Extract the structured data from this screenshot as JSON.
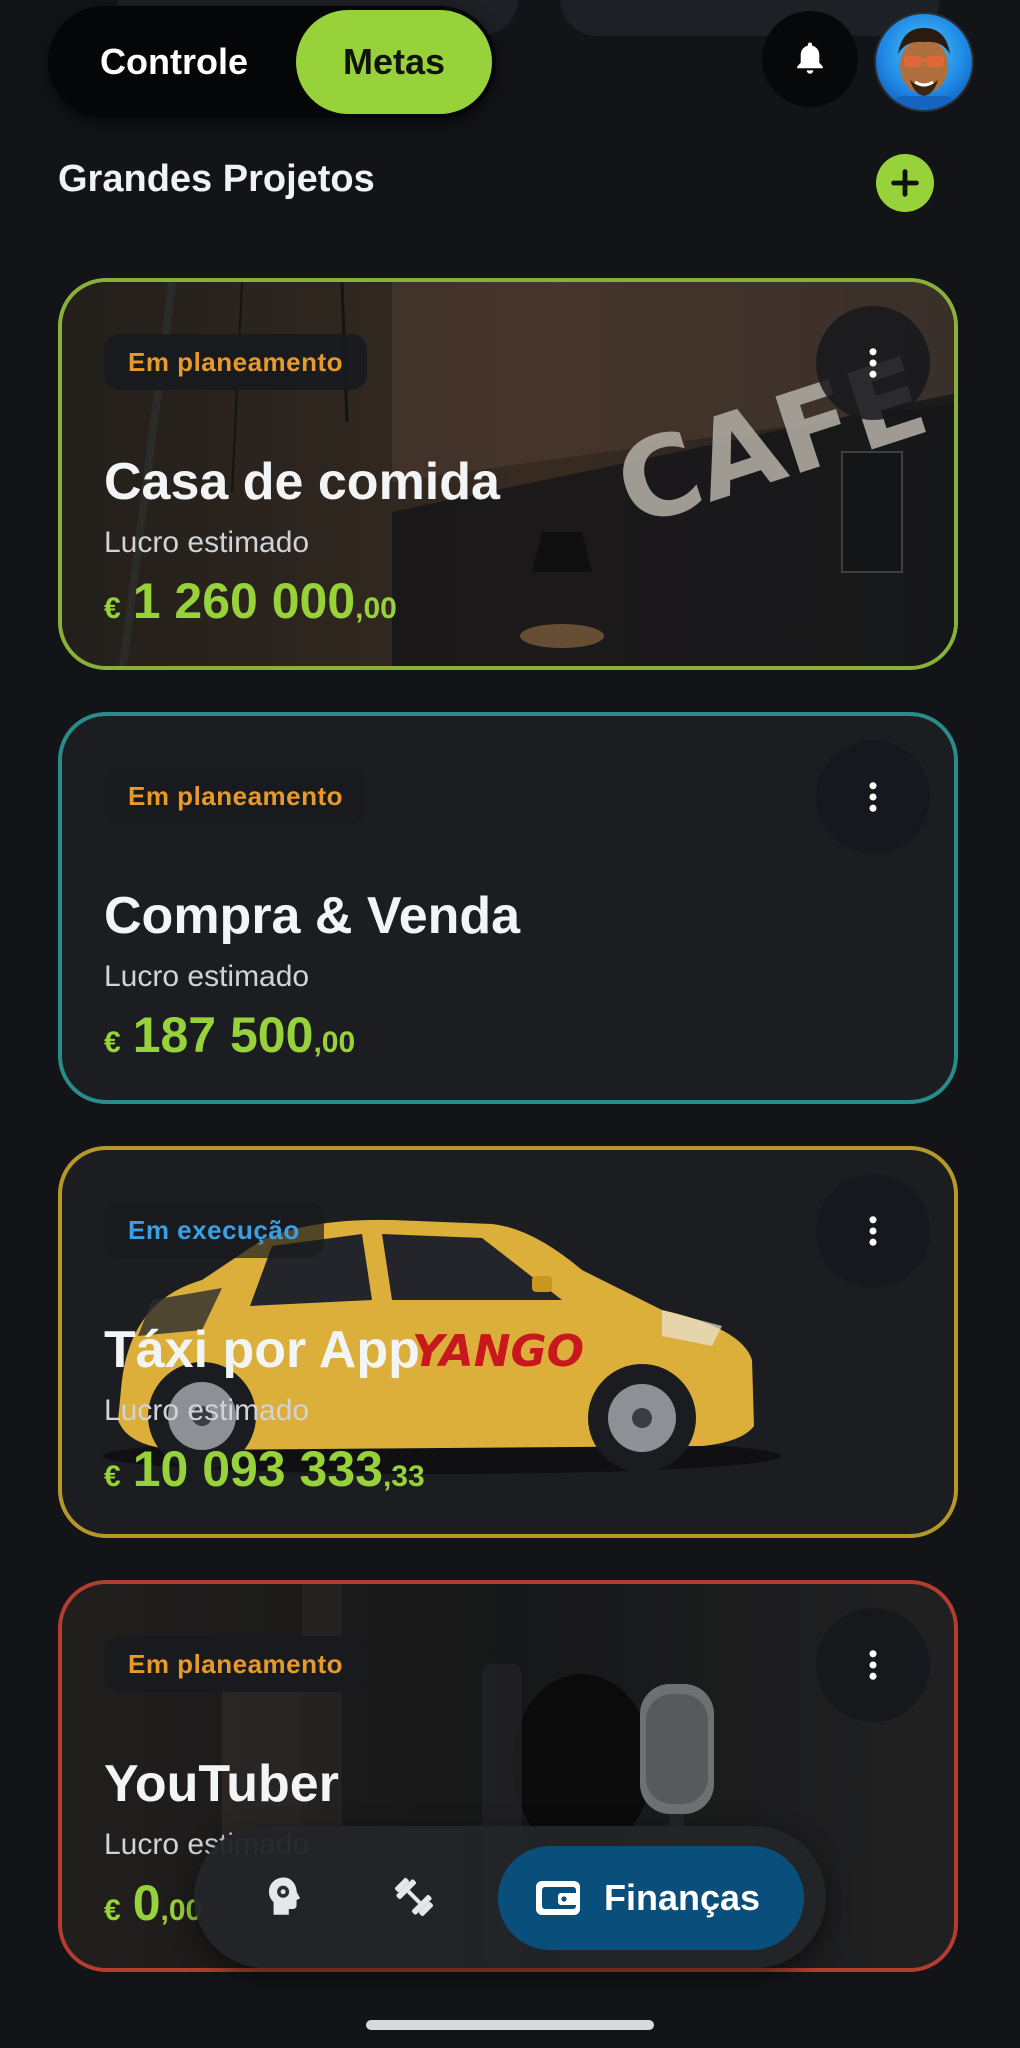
{
  "header": {
    "tabs": [
      {
        "label": "Controle",
        "active": false
      },
      {
        "label": "Metas",
        "active": true
      }
    ],
    "notification_icon": "bell-icon",
    "avatar_icon": "user-avatar"
  },
  "section": {
    "title": "Grandes Projetos",
    "add_icon": "plus-icon"
  },
  "projects": [
    {
      "status": "Em planeamento",
      "status_color": "#e79a2b",
      "name": "Casa de comida",
      "profit_label": "Lucro estimado",
      "currency": "€",
      "amount_int": "1 260 000",
      "amount_dec": ",00",
      "border_color": "#89b13a"
    },
    {
      "status": "Em planeamento",
      "status_color": "#e79a2b",
      "name": "Compra & Venda",
      "profit_label": "Lucro estimado",
      "currency": "€",
      "amount_int": "187 500",
      "amount_dec": ",00",
      "border_color": "#2a8c88"
    },
    {
      "status": "Em execução",
      "status_color": "#3aa0e6",
      "name": "Táxi por App",
      "profit_label": "Lucro estimado",
      "currency": "€",
      "amount_int": "10 093 333",
      "amount_dec": ",33",
      "border_color": "#b59828",
      "image_text": "YANGO"
    },
    {
      "status": "Em planeamento",
      "status_color": "#e79a2b",
      "name": "YouTuber",
      "profit_label": "Lucro estimado",
      "currency": "€",
      "amount_int": "0",
      "amount_dec": ",00",
      "border_color": "#b43d2f"
    }
  ],
  "bottom_nav": {
    "items": [
      {
        "icon": "brain-head-icon"
      },
      {
        "icon": "dumbbell-icon"
      },
      {
        "icon": "wallet-icon",
        "label": "Finanças",
        "active": true
      }
    ]
  },
  "colors": {
    "accent_green": "#98d23b",
    "background": "#121418",
    "nav_active": "#0a4f7c"
  }
}
